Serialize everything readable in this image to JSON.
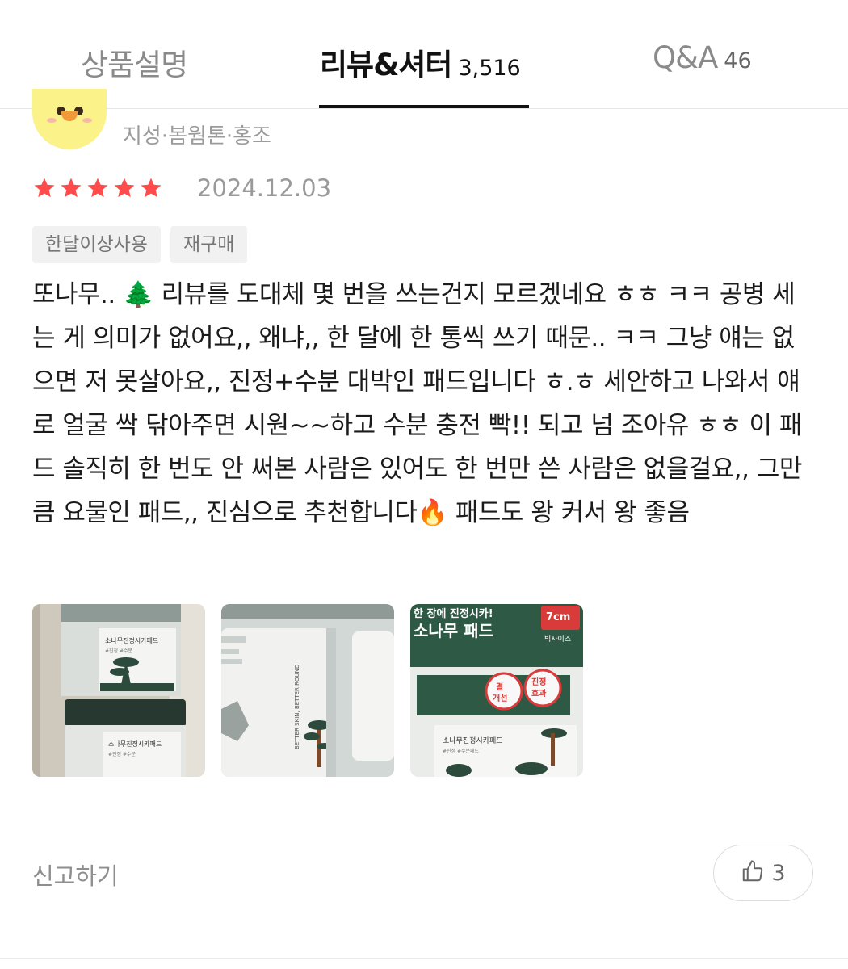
{
  "tabs": {
    "description": {
      "label": "상품설명"
    },
    "review": {
      "label": "리뷰&셔터",
      "count": "3,516"
    },
    "qa": {
      "label": "Q&A",
      "count": "46"
    }
  },
  "review": {
    "skin_info": "지성·봄웜톤·홍조",
    "rating": 5,
    "date": "2024.12.03",
    "tags": [
      "한달이상사용",
      "재구매"
    ],
    "text": "또나무.. 🌲 리뷰를 도대체 몇 번을 쓰는건지 모르겠네요 ㅎㅎ ㅋㅋ 공병 세는 게 의미가 없어요,, 왜냐,, 한 달에 한 통씩 쓰기 때문.. ㅋㅋ 그냥 얘는 없으면 저 못살아요,, 진정+수분 대박인 패드입니다 ㅎ.ㅎ 세안하고 나와서 얘로 얼굴 싹 닦아주면 시원~~하고 수분 충전 빡!! 되고 넘 조아유 ㅎㅎ 이 패드 솔직히 한 번도 안 써본 사람은 있어도 한 번만 쓴 사람은 없을걸요,, 그만큼 요물인 패드,, 진심으로 추천합니다🔥 패드도 왕 커서 왕 좋음",
    "photos": [
      {
        "label1": "소나무진정시카패드",
        "label2": "#진정 #수분"
      },
      {
        "label1": "BETTER SKIN, BETTER ROUND"
      },
      {
        "banner": "한 장에 진정시카!",
        "product": "소나무 패드",
        "badge_size": "7cm",
        "badge_sub": "빅사이즈",
        "circle1": "결\n개선",
        "circle2": "진정\n효과",
        "label1": "소나무진정시카패드",
        "label2": "#진정 #수분패드"
      }
    ],
    "report_label": "신고하기",
    "like_count": "3"
  },
  "colors": {
    "star": "#ff4b4b",
    "active_tab": "#111111",
    "inactive_tab": "#8a8a8a",
    "tag_bg": "#f1f1f1",
    "brand_green": "#2e4a3e"
  },
  "icons": [
    "star-icon",
    "thumbs-up-icon"
  ]
}
